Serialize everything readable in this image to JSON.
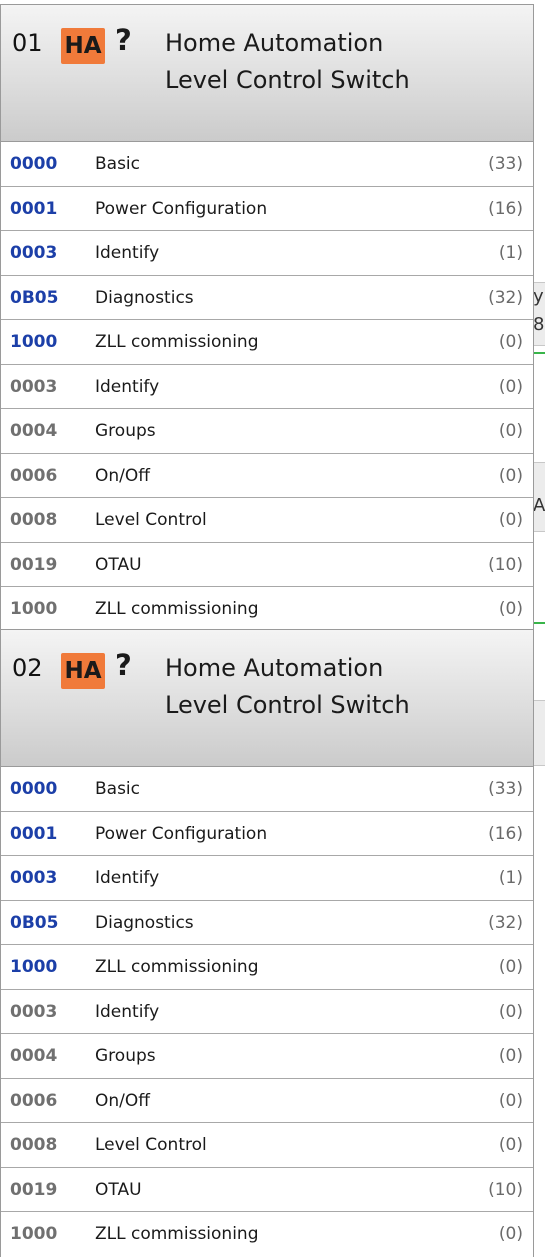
{
  "colors": {
    "server_cluster_id": "#1c3fa8",
    "client_cluster_id": "#707070",
    "badge": "#f07a3a",
    "connection_line": "#39b54a"
  },
  "background_fragments": [
    "y",
    "8",
    "A"
  ],
  "nodes": [
    {
      "index": "01",
      "profile_badge": "HA",
      "help_icon": "?",
      "title_line1": "Home Automation",
      "title_line2": "Level Control Switch",
      "clusters": [
        {
          "id": "0000",
          "name": "Basic",
          "count": "(33)",
          "side": "server"
        },
        {
          "id": "0001",
          "name": "Power Configuration",
          "count": "(16)",
          "side": "server"
        },
        {
          "id": "0003",
          "name": "Identify",
          "count": "(1)",
          "side": "server"
        },
        {
          "id": "0B05",
          "name": "Diagnostics",
          "count": "(32)",
          "side": "server"
        },
        {
          "id": "1000",
          "name": "ZLL commissioning",
          "count": "(0)",
          "side": "server"
        },
        {
          "id": "0003",
          "name": "Identify",
          "count": "(0)",
          "side": "client"
        },
        {
          "id": "0004",
          "name": "Groups",
          "count": "(0)",
          "side": "client"
        },
        {
          "id": "0006",
          "name": "On/Off",
          "count": "(0)",
          "side": "client"
        },
        {
          "id": "0008",
          "name": "Level Control",
          "count": "(0)",
          "side": "client"
        },
        {
          "id": "0019",
          "name": "OTAU",
          "count": "(10)",
          "side": "client"
        },
        {
          "id": "1000",
          "name": "ZLL commissioning",
          "count": "(0)",
          "side": "client"
        }
      ]
    },
    {
      "index": "02",
      "profile_badge": "HA",
      "help_icon": "?",
      "title_line1": "Home Automation",
      "title_line2": "Level Control Switch",
      "clusters": [
        {
          "id": "0000",
          "name": "Basic",
          "count": "(33)",
          "side": "server"
        },
        {
          "id": "0001",
          "name": "Power Configuration",
          "count": "(16)",
          "side": "server"
        },
        {
          "id": "0003",
          "name": "Identify",
          "count": "(1)",
          "side": "server"
        },
        {
          "id": "0B05",
          "name": "Diagnostics",
          "count": "(32)",
          "side": "server"
        },
        {
          "id": "1000",
          "name": "ZLL commissioning",
          "count": "(0)",
          "side": "server"
        },
        {
          "id": "0003",
          "name": "Identify",
          "count": "(0)",
          "side": "client"
        },
        {
          "id": "0004",
          "name": "Groups",
          "count": "(0)",
          "side": "client"
        },
        {
          "id": "0006",
          "name": "On/Off",
          "count": "(0)",
          "side": "client"
        },
        {
          "id": "0008",
          "name": "Level Control",
          "count": "(0)",
          "side": "client"
        },
        {
          "id": "0019",
          "name": "OTAU",
          "count": "(10)",
          "side": "client"
        },
        {
          "id": "1000",
          "name": "ZLL commissioning",
          "count": "(0)",
          "side": "client"
        }
      ]
    }
  ]
}
